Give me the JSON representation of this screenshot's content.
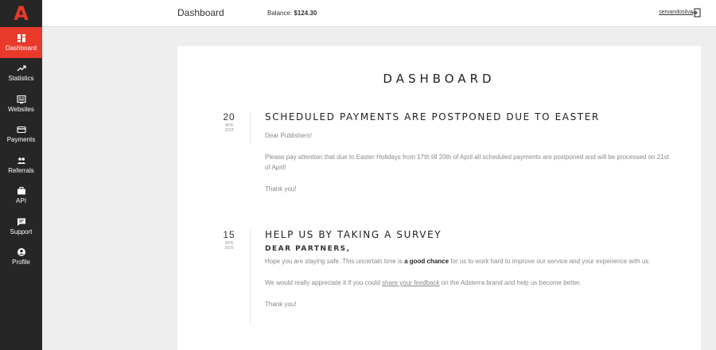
{
  "app": {
    "logo_letter": "A",
    "brand_color": "#e8392b",
    "sidebar_bg": "#262626"
  },
  "sidebar": {
    "items": [
      {
        "label": "Dashboard",
        "icon": "dashboard-icon",
        "active": true
      },
      {
        "label": "Statistics",
        "icon": "trending-up-icon",
        "active": false
      },
      {
        "label": "Websites",
        "icon": "websites-icon",
        "active": false
      },
      {
        "label": "Payments",
        "icon": "credit-card-icon",
        "active": false
      },
      {
        "label": "Referrals",
        "icon": "people-icon",
        "active": false
      },
      {
        "label": "API",
        "icon": "briefcase-icon",
        "active": false
      },
      {
        "label": "Support",
        "icon": "chat-icon",
        "active": false
      },
      {
        "label": "Profile",
        "icon": "account-icon",
        "active": false
      }
    ]
  },
  "topbar": {
    "title": "Dashboard",
    "balance_label": "Balance:",
    "balance_value": "$124.30",
    "username": "servandosilva",
    "logout_icon": "logout-icon"
  },
  "main": {
    "heading": "DASHBOARD",
    "posts": [
      {
        "day": "20",
        "month": "APR",
        "year": "2018",
        "title": "SCHEDULED PAYMENTS ARE POSTPONED DUE TO EASTER",
        "paragraphs": [
          "Dear Publishers!",
          "Please pay attention that due to Easter Holidays from 17th till 20th of April all scheduled payments are postponed and will be processed on 21st of April!",
          "Thank you!"
        ]
      },
      {
        "day": "15",
        "month": "APR",
        "year": "2020",
        "title": "HELP US BY TAKING A SURVEY",
        "subtitle": "DEAR PARTNERS,",
        "p1_before": "Hope you are staying safe. This uncertain time is ",
        "p1_bold": "a good chance",
        "p1_after": " for us to work hard to improve our service and your experience with us.",
        "p2_before": "We would really appreciate it if you could ",
        "p2_link": "share your feedback",
        "p2_after": " on the Adsterra brand and help us become better.",
        "p3": "Thank you!"
      }
    ]
  }
}
